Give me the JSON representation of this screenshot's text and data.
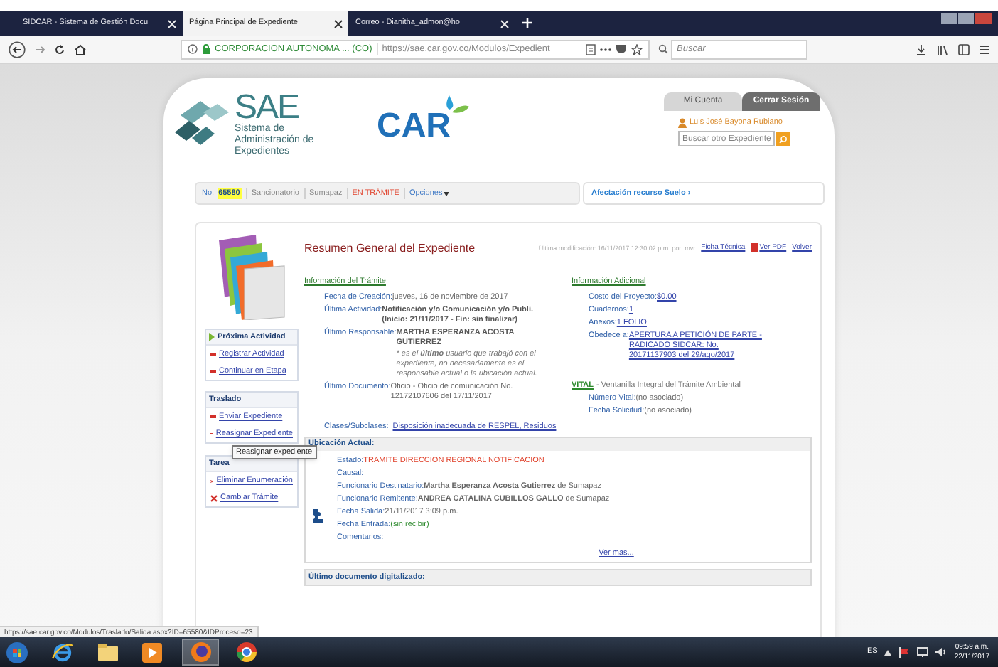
{
  "browser": {
    "tabs": [
      {
        "label": "SIDCAR - Sistema de Gestión Docu",
        "selected": false
      },
      {
        "label": "Página Principal de Expediente",
        "selected": true
      },
      {
        "label": "Correo - Dianitha_admon@ho",
        "selected": false
      }
    ],
    "identity": "CORPORACION AUTONOMA ... (CO)",
    "url": "https://sae.car.gov.co/Modulos/Expedient",
    "search_placeholder": "Buscar"
  },
  "header": {
    "logo": "SAE",
    "logo_subtitle": "Sistema de Administración de Expedientes",
    "partner_logo": "CAR",
    "account_links": [
      "Mi Cuenta",
      "Cerrar Sesión"
    ],
    "user": "Luis José Bayona Rubiano",
    "search_placeholder": "Buscar otro Expediente"
  },
  "record_bar": {
    "number_label": "No.",
    "number": "65580",
    "items": [
      {
        "label": "Sancionatorio",
        "kind": "text"
      },
      {
        "label": "Sumapaz",
        "kind": "text"
      },
      {
        "label": "EN TRÁMITE",
        "kind": "status"
      },
      {
        "label": "Opciones",
        "kind": "menu"
      }
    ],
    "resource_link": "Afectación recurso Suelo ›"
  },
  "sidebar": [
    {
      "title": "Próxima Actividad",
      "kind": "next",
      "items": [
        {
          "label": "Registrar Actividad",
          "kind": "dash"
        },
        {
          "label": "Continuar en Etapa",
          "kind": "dash"
        }
      ]
    },
    {
      "title": "Traslado",
      "kind": "plain",
      "items": [
        {
          "label": "Enviar Expediente",
          "kind": "dash"
        },
        {
          "label": "Reasignar Expediente",
          "kind": "dash"
        }
      ]
    },
    {
      "title": "Tarea",
      "kind": "plain",
      "items": [
        {
          "label": "Eliminar Enumeración",
          "kind": "cross"
        },
        {
          "label": "Cambiar Trámite",
          "kind": "cross"
        }
      ]
    }
  ],
  "tooltip": "Reasignar expediente",
  "summary": {
    "title": "Resumen General del Expediente",
    "modified": "Última modificación: 16/11/2017 12:30:02 p.m. por: mvr",
    "links": [
      {
        "label": "Ficha Técnica",
        "kind": "link"
      },
      {
        "label": "Ver PDF",
        "kind": "pdf"
      },
      {
        "label": "Volver",
        "kind": "link"
      }
    ],
    "tramite": {
      "heading": "Información del Trámite",
      "rows": [
        {
          "label": "Fecha de Creación:",
          "value": "jueves, 16 de noviembre de 2017",
          "kind": "plain"
        },
        {
          "label": "Última Actividad:",
          "value": "Notificación y/o Comunicación y/o Publi. **(Inicio: 21/11/2017 - Fin: sin finalizar)**",
          "kind": "activity"
        },
        {
          "label": "Último Responsable:",
          "value": "MARTHA ESPERANZA ACOSTA GUTIERREZ",
          "note": "* es el **último** usuario que trabajó con el expediente, no necesariamente es el responsable actual o la ubicación actual.",
          "kind": "bold"
        },
        {
          "label": "Último Documento:",
          "value": "Oficio - Oficio de comunicación No. 12172107606 del 17/11/2017",
          "kind": "plain"
        }
      ]
    },
    "adicional": {
      "heading": "Información Adicional",
      "rows": [
        {
          "label": "Costo del Proyecto:",
          "value": "$0.00",
          "kind": "link"
        },
        {
          "label": "Cuadernos:",
          "value": "1",
          "kind": "link"
        },
        {
          "label": "Anexos:",
          "value": "1 FOLIO",
          "kind": "link"
        },
        {
          "label": "Obedece a:",
          "value": "APERTURA A PETICIÓN DE PARTE - RADICADO SIDCAR: No. 20171137903 del 29/ago/2017",
          "kind": "link"
        }
      ]
    },
    "vital": {
      "tag": "VITAL",
      "text": "- Ventanilla Integral del Trámite Ambiental",
      "rows": [
        {
          "label": "Número Vital:",
          "value": "(no asociado)",
          "kind": "plain"
        },
        {
          "label": "Fecha Solicitud:",
          "value": "(no asociado)",
          "kind": "plain"
        }
      ]
    },
    "classes": {
      "label": "Clases/Subclases:",
      "value": "Disposición inadecuada de RESPEL, Residuos"
    },
    "location": {
      "heading": "Ubicación Actual:",
      "rows": [
        {
          "label": "Estado:",
          "value": "TRAMITE DIRECCION REGIONAL NOTIFICACION",
          "kind": "alert"
        },
        {
          "label": "Causal:"
        },
        {
          "label": "Funcionario Destinatario:",
          "value": "**Martha Esperanza Acosta Gutierrez** de Sumapaz",
          "kind": "plain"
        },
        {
          "label": "Funcionario Remitente:",
          "value": "**ANDREA CATALINA CUBILLOS GALLO** de Sumapaz",
          "kind": "plain"
        },
        {
          "label": "Fecha Salida:",
          "value": "21/11/2017 3:09 p.m.",
          "kind": "plain"
        },
        {
          "label": "Fecha Entrada:",
          "value": "(sin recibir)",
          "kind": "ok"
        },
        {
          "label": "Comentarios:"
        }
      ],
      "more_link": "Ver mas..."
    },
    "digitized": {
      "heading": "Último documento digitalizado:"
    }
  },
  "status_url": "https://sae.car.gov.co/Modulos/Traslado/Salida.aspx?ID=65580&IDProceso=23",
  "taskbar": {
    "language": "ES",
    "time": "09:59 a.m.",
    "date": "22/11/2017"
  }
}
